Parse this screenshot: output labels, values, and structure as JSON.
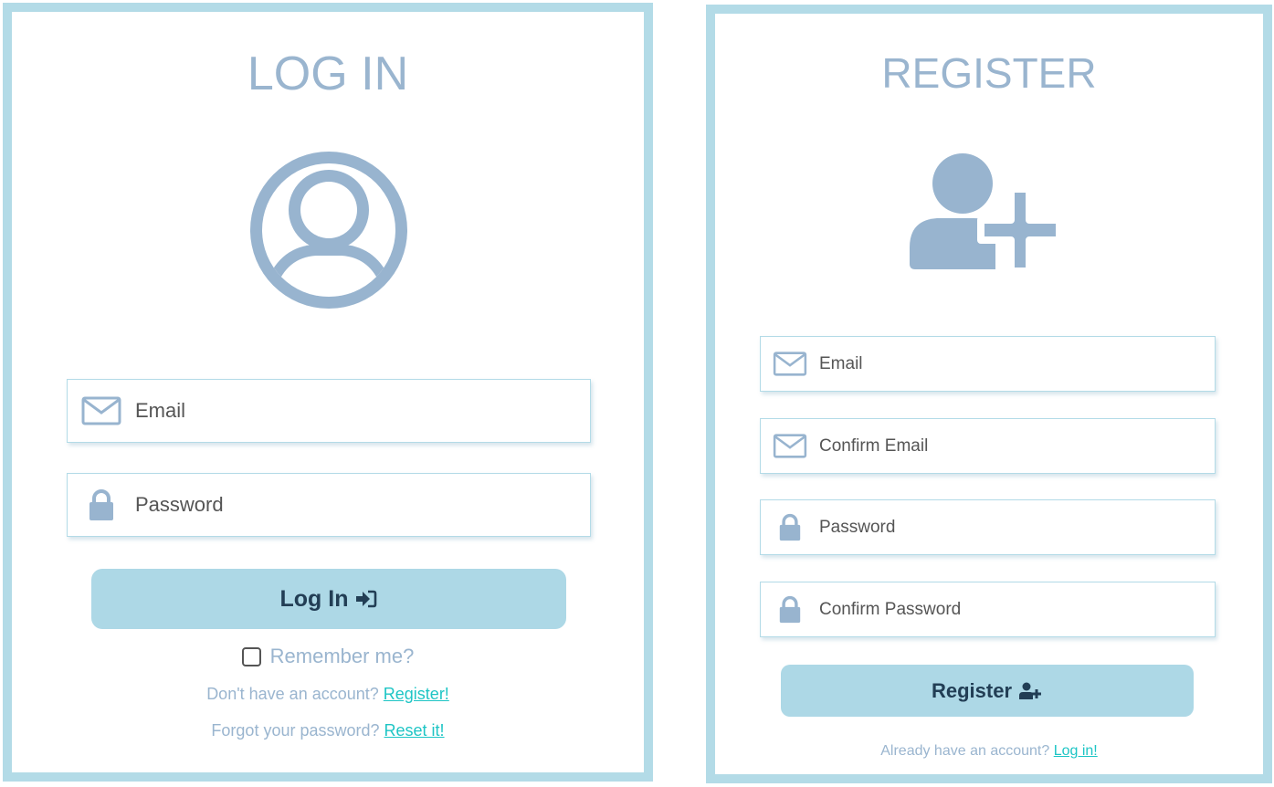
{
  "login": {
    "title": "LOG IN",
    "email_placeholder": "Email",
    "password_placeholder": "Password",
    "button_label": "Log In",
    "remember_label": "Remember me?",
    "no_account_text": "Don't have an account?",
    "register_link": "Register!",
    "forgot_text": "Forgot your password?",
    "reset_link": "Reset it!"
  },
  "register": {
    "title": "REGISTER",
    "email_placeholder": "Email",
    "confirm_email_placeholder": "Confirm Email",
    "password_placeholder": "Password",
    "confirm_password_placeholder": "Confirm Password",
    "button_label": "Register",
    "have_account_text": "Already have an account?",
    "login_link": "Log in!"
  },
  "icons": {
    "login_avatar": "user-circle-icon",
    "register_avatar": "user-plus-icon",
    "email": "envelope-icon",
    "password": "lock-icon",
    "login_button": "sign-in-icon",
    "register_button": "user-plus-icon"
  },
  "colors": {
    "panel_border": "#b3dbe7",
    "title": "#9ab5cf",
    "icon": "#98b4cf",
    "button_bg": "#add8e6",
    "button_text": "#223e55",
    "link": "#1ec5c5"
  }
}
